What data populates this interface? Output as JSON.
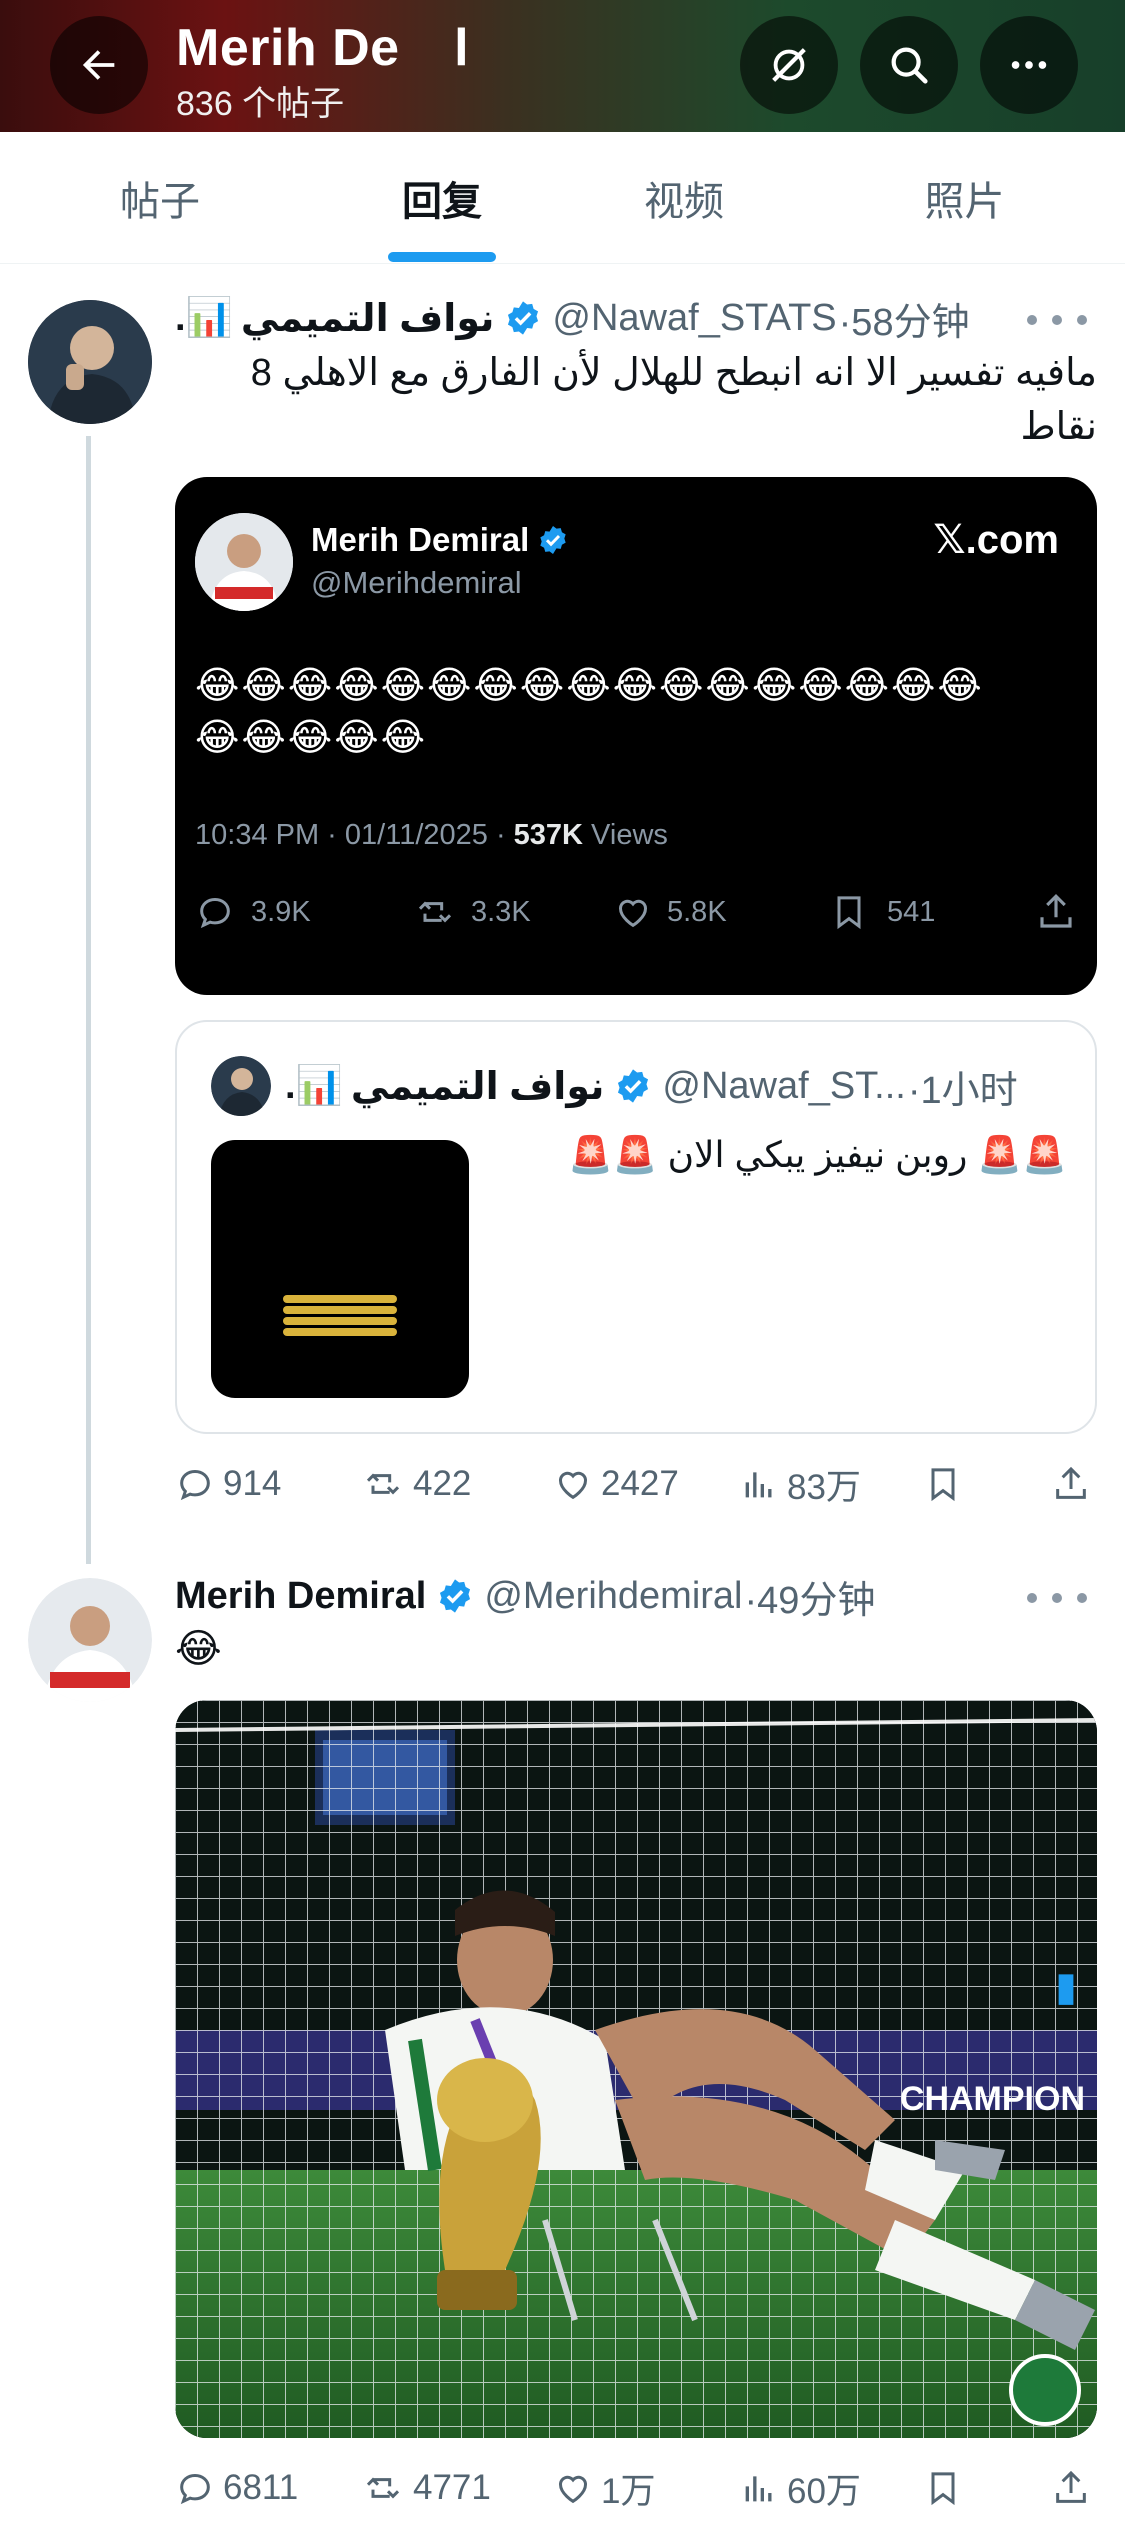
{
  "header": {
    "title": "Merih De     l",
    "post_count": "836 个帖子"
  },
  "tabs": [
    {
      "label": "帖子"
    },
    {
      "label": "回复"
    },
    {
      "label": "视频"
    },
    {
      "label": "照片"
    }
  ],
  "tweet1": {
    "name": "نواف التميمي",
    "name_suffix": ".📊",
    "handle": "@Nawaf_STATS",
    "time": "·58分钟",
    "text": "مافيه تفسير الا انه انبطح للهلال لأن الفارق مع الاهلي 8 نقاط",
    "embed": {
      "name": "Merih Demiral",
      "handle": "@Merihdemiral",
      "brand": "𝕏.com",
      "emoji_line1": "😂😂😂😂😂😂😂😂😂😂😂😂😂😂😂😂😂",
      "emoji_line2": "😂😂😂😂😂",
      "timestamp": "10:34 PM · 01/11/2025 · ",
      "views_count": "537K",
      "views_label": " Views",
      "replies": "3.9K",
      "reposts": "3.3K",
      "likes": "5.8K",
      "bookmarks": "541"
    },
    "quote": {
      "name": "نواف التميمي",
      "name_suffix": ".📊",
      "handle": "@Nawaf_ST...",
      "time": "·1小时",
      "text": "🚨🚨 روبن نيفيز يبكي الان 🚨🚨"
    },
    "stats": {
      "replies": "914",
      "reposts": "422",
      "likes": "2427",
      "views": "83万"
    }
  },
  "tweet2": {
    "name": "Merih Demiral",
    "handle": "@Merihdemiral",
    "time": "·49分钟",
    "text": "😂",
    "photo_banner": "CHAMPION",
    "stats": {
      "replies": "6811",
      "reposts": "4771",
      "likes": "1万",
      "views": "60万"
    }
  }
}
